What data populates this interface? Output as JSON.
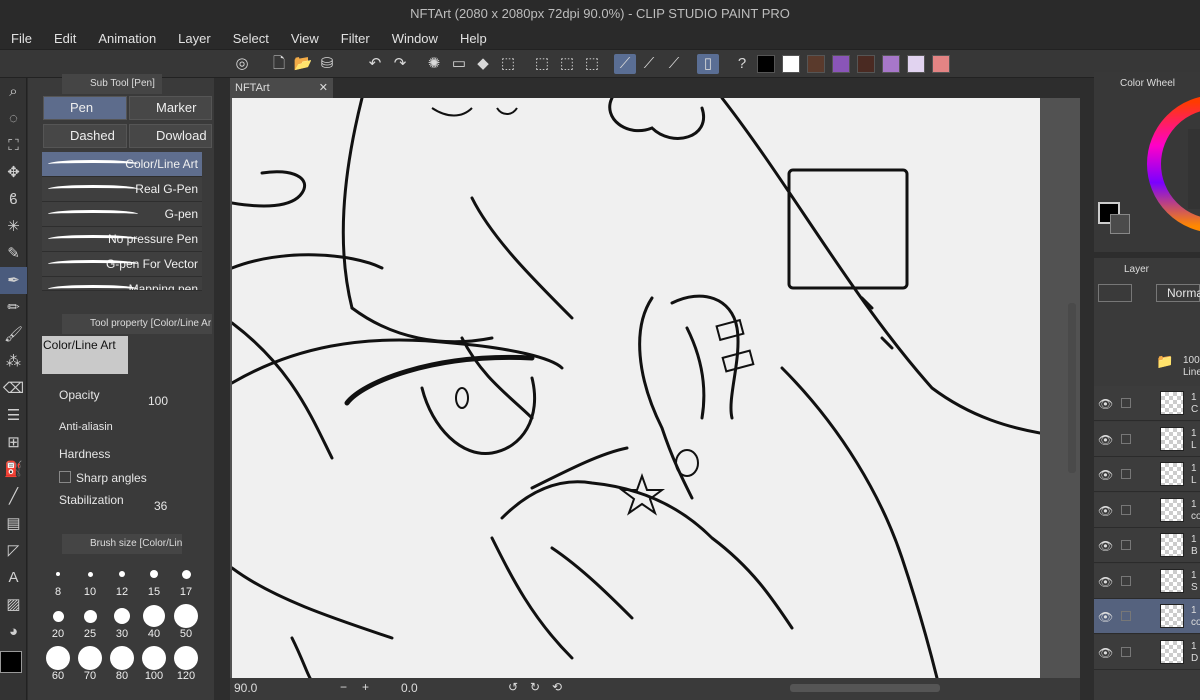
{
  "window": {
    "title": "NFTArt (2080 x 2080px 72dpi 90.0%)  - CLIP STUDIO PAINT PRO"
  },
  "menu": [
    "File",
    "Edit",
    "Animation",
    "Layer",
    "Select",
    "View",
    "Filter",
    "Window",
    "Help"
  ],
  "toolbar": {
    "colors": [
      "#000000",
      "#ffffff",
      "#5a3a2c",
      "#8a55b8",
      "#4a2a22",
      "#a777c9",
      "#e1d3f0",
      "#e38484"
    ]
  },
  "subtool": {
    "panel_title": "Sub Tool [Pen]",
    "tabs": [
      "Pen",
      "Marker",
      "Dashed ro",
      "Dowload"
    ],
    "brushes": [
      "Color/Line Art",
      "Real G-Pen",
      "G-pen",
      "No pressure Pen",
      "G-pen For Vector",
      "Mapping pen"
    ]
  },
  "toolprop": {
    "panel_title": "Tool property [Color/Line Ar",
    "preview_label": "Color/Line Art",
    "opacity_label": "Opacity",
    "opacity_value": "100",
    "antialias_label": "Anti-aliasin",
    "hardness_label": "Hardness",
    "sharp_label": "Sharp angles",
    "stab_label": "Stabilization",
    "stab_value": "36"
  },
  "brushsize": {
    "panel_title": "Brush size [Color/Lin",
    "sizes": [
      "8",
      "10",
      "12",
      "15",
      "17",
      "20",
      "25",
      "30",
      "40",
      "50",
      "60",
      "70",
      "80",
      "100",
      "120"
    ]
  },
  "document": {
    "tab": "NFTArt",
    "zoom": "90.0",
    "angle": "0.0"
  },
  "colorwheel": {
    "title": "Color Wheel"
  },
  "layers": {
    "title": "Layer",
    "blend": "Normal",
    "folder_name": [
      "100",
      "Line"
    ],
    "rows": [
      [
        "1",
        "C"
      ],
      [
        "1",
        "L"
      ],
      [
        "1",
        "L"
      ],
      [
        "1",
        "co"
      ],
      [
        "1",
        "B"
      ],
      [
        "1",
        "S"
      ],
      [
        "1",
        "co"
      ],
      [
        "1",
        "D"
      ]
    ]
  }
}
